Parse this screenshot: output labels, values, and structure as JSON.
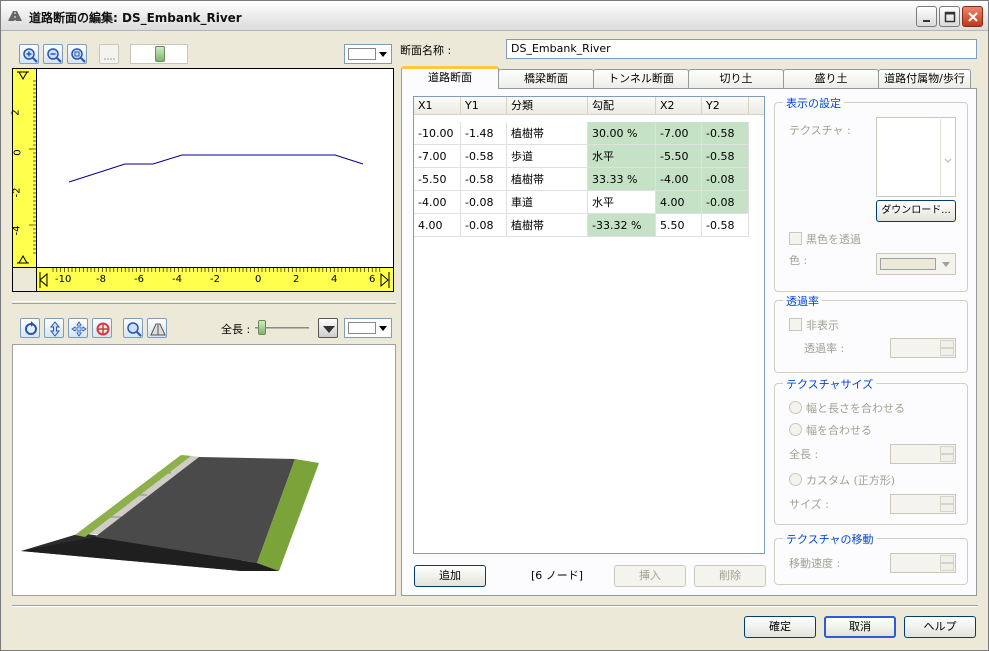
{
  "window": {
    "title": "道路断面の編集: DS_Embank_River"
  },
  "left_top": {
    "ruler_v_ticks": [
      "2",
      "0",
      "-2",
      "-4"
    ],
    "ruler_h_ticks": [
      "-10",
      "-8",
      "-6",
      "-4",
      "-2",
      "0",
      "2",
      "4",
      "6"
    ]
  },
  "left_3d": {
    "length_label": "全長 :"
  },
  "right": {
    "name_label": "断面名称 :",
    "name_value": "DS_Embank_River",
    "tabs": [
      "道路断面",
      "橋梁断面",
      "トンネル断面",
      "切り土",
      "盛り土",
      "道路付属物/歩行"
    ],
    "grid": {
      "headers": [
        "X1",
        "Y1",
        "分類",
        "勾配",
        "X2",
        "Y2"
      ],
      "rows": [
        [
          "-10.00",
          "-1.48",
          "植樹帯",
          "30.00 %",
          "-7.00",
          "-0.58"
        ],
        [
          "-7.00",
          "-0.58",
          "歩道",
          "水平",
          "-5.50",
          "-0.58"
        ],
        [
          "-5.50",
          "-0.58",
          "植樹帯",
          "33.33 %",
          "-4.00",
          "-0.08"
        ],
        [
          "-4.00",
          "-0.08",
          "車道",
          "水平",
          "4.00",
          "-0.08"
        ],
        [
          "4.00",
          "-0.08",
          "植樹帯",
          "-33.32 %",
          "5.50",
          "-0.58"
        ]
      ]
    },
    "add_label": "追加",
    "node_count": "[6 ノード]",
    "insert_label": "挿入",
    "delete_label": "削除",
    "display": {
      "title": "表示の設定",
      "texture_label": "テクスチャ :",
      "download_label": "ダウンロード...",
      "black_transparent_label": "黒色を透過",
      "color_label": "色 :"
    },
    "transparency": {
      "title": "透過率",
      "hide_label": "非表示",
      "rate_label": "透過率 :"
    },
    "texture_size": {
      "title": "テクスチャサイズ",
      "opt1": "幅と長さを合わせる",
      "opt2": "幅を合わせる",
      "length_label": "全長 :",
      "opt3": "カスタム (正方形)",
      "size_label": "サイズ :"
    },
    "texture_move": {
      "title": "テクスチャの移動",
      "speed_label": "移動速度 :"
    }
  },
  "footer": {
    "ok": "確定",
    "cancel": "取消",
    "help": "ヘルプ"
  }
}
